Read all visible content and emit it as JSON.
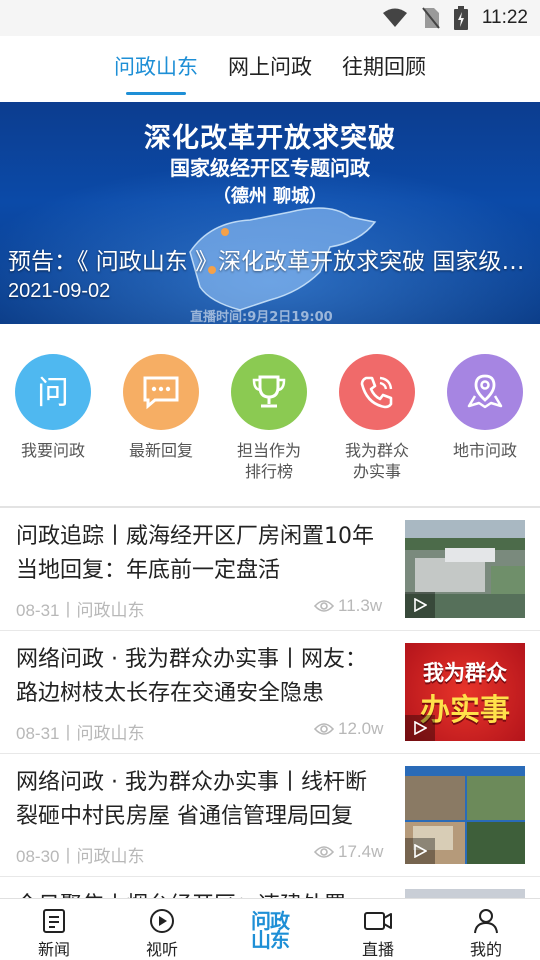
{
  "status_bar": {
    "time": "11:22",
    "icons": [
      "wifi-icon",
      "no-sim-icon",
      "battery-charging-icon"
    ]
  },
  "top_tabs": [
    {
      "label": "问政山东",
      "active": true
    },
    {
      "label": "网上问政",
      "active": false
    },
    {
      "label": "往期回顾",
      "active": false
    }
  ],
  "banner": {
    "headline": "深化改革开放求突破",
    "subline": "国家级经开区专题问政",
    "cities": "（德州  聊城）",
    "live_time": "直播时间:9月2日19:00",
    "caption_title": "预告：《 问政山东 》深化改革开放求突破 国家级经开区专题问政",
    "caption_date": "2021-09-02"
  },
  "quick_links": [
    {
      "label": "我要问政",
      "icon": "ask-icon",
      "color": "#4fb8f0"
    },
    {
      "label": "最新回复",
      "icon": "message-icon",
      "color": "#f6ae64"
    },
    {
      "label": "担当作为\n排行榜",
      "icon": "trophy-icon",
      "color": "#8bca52"
    },
    {
      "label": "我为群众\n办实事",
      "icon": "phone-icon",
      "color": "#f06a6a"
    },
    {
      "label": "地市问政",
      "icon": "map-location-icon",
      "color": "#a685e2"
    }
  ],
  "news": [
    {
      "title": "问政追踪丨威海经开区厂房闲置10年 当地回复：年底前一定盘活",
      "meta": "08-31丨问政山东",
      "views": "11.3w",
      "thumb": "factory-aerial"
    },
    {
      "title": "网络问政 · 我为群众办实事丨网友：路边树枝太长存在交通安全隐患",
      "meta": "08-31丨问政山东",
      "views": "12.0w",
      "thumb": "promo-graphic",
      "thumb_text_1": "我为群众",
      "thumb_text_2": "办实事"
    },
    {
      "title": "网络问政 · 我为群众办实事丨线杆断裂砸中村民房屋 省通信管理局回复",
      "meta": "08-30丨问政山东",
      "views": "17.4w",
      "thumb": "village-collage"
    },
    {
      "title": "今日聚焦丨烟台经开区：违建处置",
      "meta": "",
      "views": "",
      "thumb": "building"
    }
  ],
  "bottom_nav": [
    {
      "label": "新闻",
      "icon": "news-icon"
    },
    {
      "label": "视听",
      "icon": "play-circle-icon"
    },
    {
      "label": "问政\n山东",
      "icon": "brand-logo",
      "active": true
    },
    {
      "label": "直播",
      "icon": "video-camera-icon"
    },
    {
      "label": "我的",
      "icon": "profile-icon"
    }
  ],
  "colors": {
    "accent": "#1e8fd6",
    "meta_text": "#b8b8b8"
  }
}
